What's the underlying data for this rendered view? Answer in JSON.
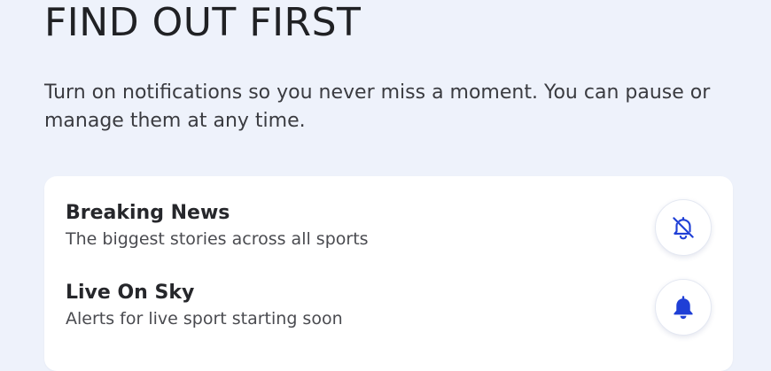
{
  "page": {
    "heading": "FIND OUT FIRST",
    "intro": "Turn on notifications so you never miss a moment. You can pause or manage them at any time."
  },
  "notifications": {
    "items": [
      {
        "title": "Breaking News",
        "description": "The biggest stories across all sports",
        "state": "off",
        "icon": "bell-off-icon"
      },
      {
        "title": "Live On Sky",
        "description": "Alerts for live sport starting soon",
        "state": "on",
        "icon": "bell-filled-icon"
      }
    ]
  },
  "colors": {
    "background": "#eef2fb",
    "card": "#ffffff",
    "accent": "#1f3fd6",
    "text": "#26272b"
  }
}
